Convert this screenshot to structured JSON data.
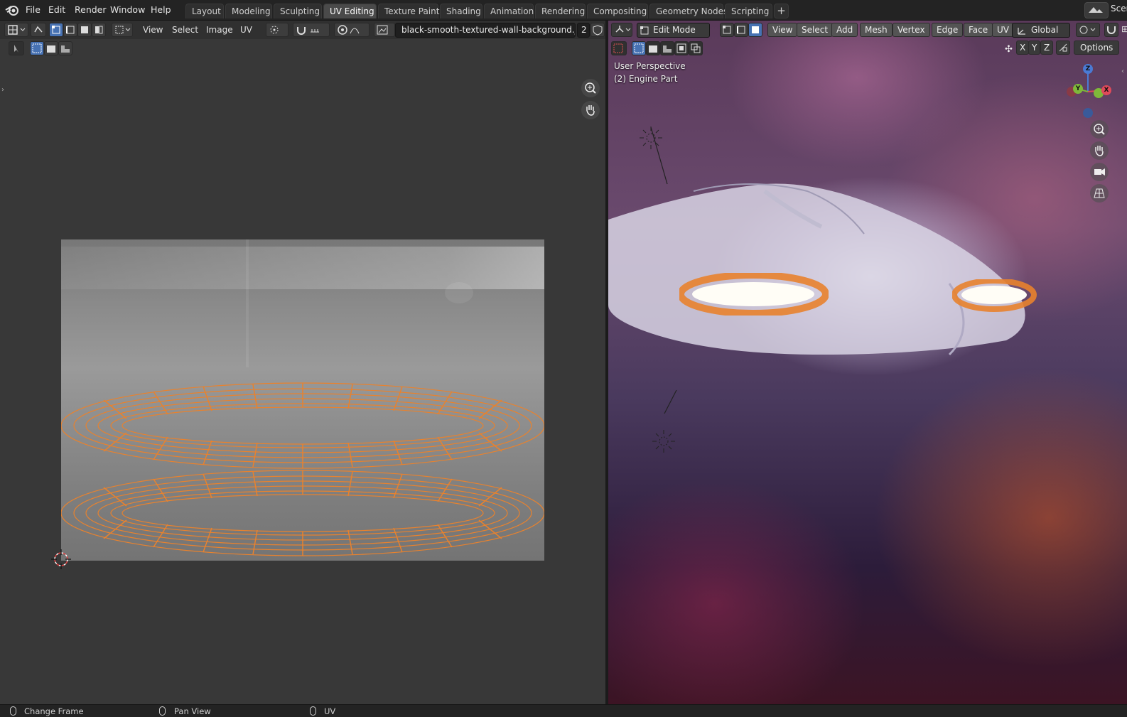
{
  "topbar": {
    "menus": [
      "File",
      "Edit",
      "Render",
      "Window",
      "Help"
    ],
    "workspaces": [
      "Layout",
      "Modeling",
      "Sculpting",
      "UV Editing",
      "Texture Paint",
      "Shading",
      "Animation",
      "Rendering",
      "Compositing",
      "Geometry Nodes",
      "Scripting"
    ],
    "active_workspace": "UV Editing",
    "scene_label": "Scen"
  },
  "uv_editor": {
    "menus": [
      "View",
      "Select",
      "Image",
      "UV"
    ],
    "image_name": "black-smooth-textured-wall-background.jpg",
    "image_users": "2"
  },
  "viewport": {
    "mode": "Edit Mode",
    "menus": [
      "View",
      "Select",
      "Add",
      "Mesh",
      "Vertex",
      "Edge",
      "Face",
      "UV"
    ],
    "orientation": "Global",
    "axis_buttons": [
      "X",
      "Y",
      "Z"
    ],
    "options_label": "Options",
    "perspective_label": "User Perspective",
    "object_label": "(2) Engine Part",
    "gizmo_labels": {
      "z": "Z",
      "y": "Y",
      "x": "X"
    }
  },
  "statusbar": {
    "items": [
      "Change Frame",
      "Pan View",
      "UV"
    ]
  },
  "colors": {
    "accent": "#4772b3",
    "uv_edge": "#e8822e"
  }
}
